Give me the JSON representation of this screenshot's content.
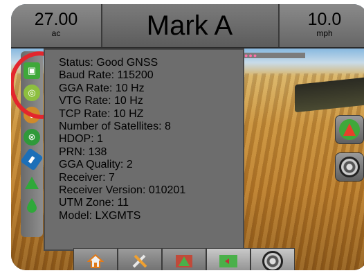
{
  "header": {
    "area_value": "27.00",
    "area_unit": "ac",
    "title": "Mark A",
    "speed_value": "10.0",
    "speed_unit": "mph"
  },
  "gnss_status": {
    "lines": [
      "Status: Good GNSS",
      "Baud Rate:  115200",
      "GGA Rate: 10 Hz",
      "VTG Rate: 10 Hz",
      "TCP Rate: 10 HZ",
      "Number of Satellites: 8",
      "HDOP: 1",
      "PRN: 138",
      "GGA Quality: 2",
      "Receiver: 7",
      "Receiver Version: 010201",
      "UTM Zone: 11",
      "Model: LXGMTS"
    ]
  },
  "lightbar_dots": "●●●",
  "sidebar_icons": [
    "gnss-status-icon",
    "guidance-mode-icon",
    "boom-status-icon",
    "steering-icon",
    "tilt-icon",
    "mark-icon",
    "application-rate-icon"
  ],
  "bottom_nav": [
    "home-icon",
    "system-setup-icon",
    "guidance-icon",
    "field-map-icon",
    "camera-icon"
  ],
  "colors": {
    "highlight_circle": "#e3262d",
    "status_green": "#3fa83a",
    "popup_bg": "#6d6d6d"
  }
}
